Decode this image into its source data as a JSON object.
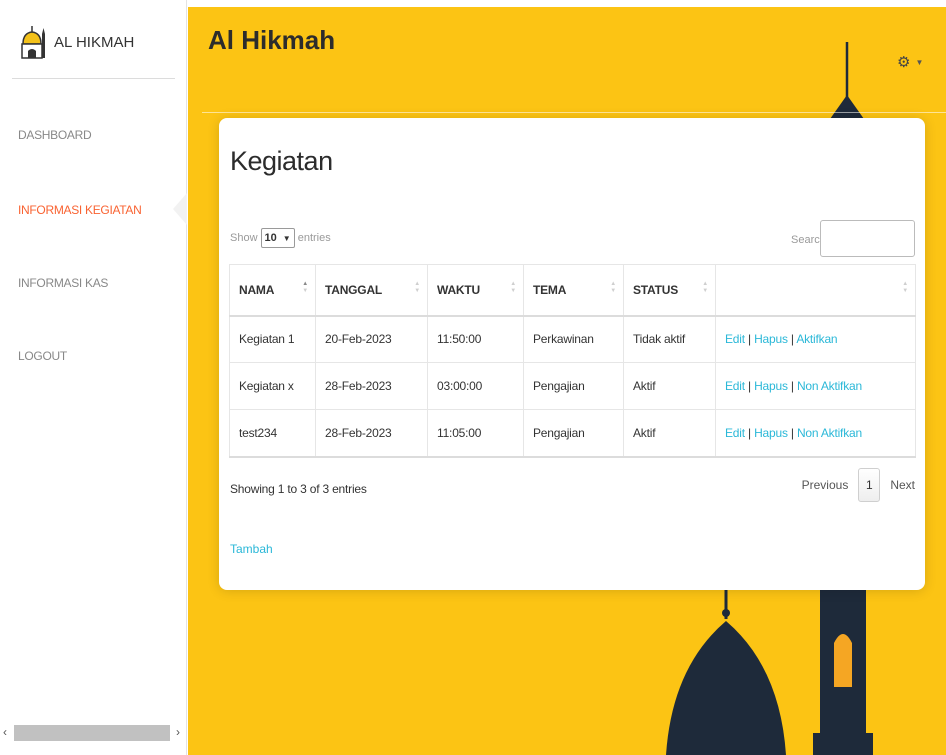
{
  "sidebar": {
    "logo_text": "AL HIKMAH",
    "items": [
      {
        "label": "DASHBOARD",
        "active": false
      },
      {
        "label": "INFORMASI KEGIATAN",
        "active": true
      },
      {
        "label": "INFORMASI KAS",
        "active": false
      },
      {
        "label": "LOGOUT",
        "active": false
      }
    ]
  },
  "header": {
    "brand": "Al Hikmah",
    "settings_icon": "gear-icon"
  },
  "card": {
    "title": "Kegiatan",
    "length": {
      "before": "Show",
      "value": "10",
      "after": "entries"
    },
    "search_label": "Search:",
    "search_value": "",
    "columns": [
      "NAMA",
      "TANGGAL",
      "WAKTU",
      "TEMA",
      "STATUS",
      ""
    ],
    "rows": [
      {
        "nama": "Kegiatan 1",
        "tanggal": "20-Feb-2023",
        "waktu": "11:50:00",
        "tema": "Perkawinan",
        "status": "Tidak aktif",
        "edit": "Edit",
        "hapus": "Hapus",
        "toggle": "Aktifkan"
      },
      {
        "nama": "Kegiatan x",
        "tanggal": "28-Feb-2023",
        "waktu": "03:00:00",
        "tema": "Pengajian",
        "status": "Aktif",
        "edit": "Edit",
        "hapus": "Hapus",
        "toggle": "Non Aktifkan"
      },
      {
        "nama": "test234",
        "tanggal": "28-Feb-2023",
        "waktu": "11:05:00",
        "tema": "Pengajian",
        "status": "Aktif",
        "edit": "Edit",
        "hapus": "Hapus",
        "toggle": "Non Aktifkan"
      }
    ],
    "info": "Showing 1 to 3 of 3 entries",
    "pager": {
      "previous": "Previous",
      "page": "1",
      "next": "Next"
    },
    "add_label": "Tambah"
  },
  "colors": {
    "accent": "#fcc414",
    "active_nav": "#f96332",
    "link": "#2bb8d8",
    "dome": "#1e2a3a"
  }
}
